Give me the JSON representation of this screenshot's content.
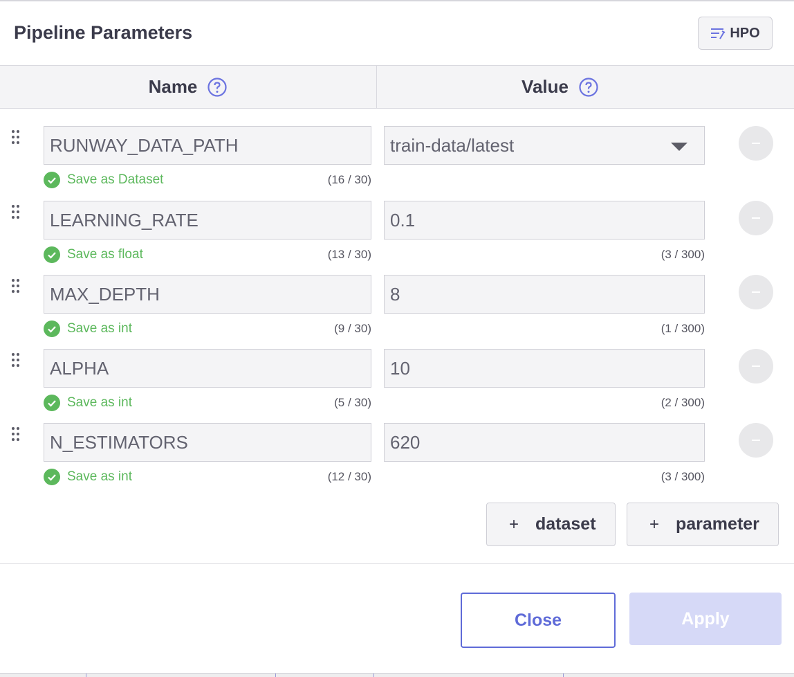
{
  "header": {
    "title": "Pipeline Parameters",
    "hpo_label": "HPO"
  },
  "table": {
    "name_header": "Name",
    "value_header": "Value"
  },
  "rows": [
    {
      "name": "RUNWAY_DATA_PATH",
      "value": "train-data/latest",
      "value_kind": "select",
      "save_label": "Save as Dataset",
      "name_count": "(16 / 30)",
      "value_count": ""
    },
    {
      "name": "LEARNING_RATE",
      "value": "0.1",
      "value_kind": "text",
      "save_label": "Save as float",
      "name_count": "(13 / 30)",
      "value_count": "(3 / 300)"
    },
    {
      "name": "MAX_DEPTH",
      "value": "8",
      "value_kind": "text",
      "save_label": "Save as int",
      "name_count": "(9 / 30)",
      "value_count": "(1 / 300)"
    },
    {
      "name": "ALPHA",
      "value": "10",
      "value_kind": "text",
      "save_label": "Save as int",
      "name_count": "(5 / 30)",
      "value_count": "(2 / 300)"
    },
    {
      "name": "N_ESTIMATORS",
      "value": "620",
      "value_kind": "text",
      "save_label": "Save as int",
      "name_count": "(12 / 30)",
      "value_count": "(3 / 300)"
    }
  ],
  "actions": {
    "add_dataset_label": "dataset",
    "add_parameter_label": "parameter",
    "plus_glyph": "+"
  },
  "footer": {
    "close_label": "Close",
    "apply_label": "Apply"
  },
  "colors": {
    "accent": "#5f6bd8",
    "success": "#5cb85c",
    "apply_disabled": "#d6d9f7"
  },
  "icons": {
    "hpo": "tune-sliders-icon",
    "help": "question-circle-icon",
    "check": "check-circle-icon",
    "drag": "drag-handle-icon",
    "remove": "minus-circle-icon",
    "dropdown": "caret-down-icon"
  }
}
